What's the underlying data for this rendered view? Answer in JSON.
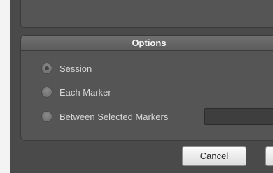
{
  "options": {
    "title": "Options",
    "radios": [
      {
        "label": "Session",
        "checked": true
      },
      {
        "label": "Each Marker",
        "checked": false
      },
      {
        "label": "Between Selected Markers",
        "checked": false
      }
    ],
    "markers_field_value": ""
  },
  "buttons": {
    "cancel": "Cancel",
    "ok": ""
  }
}
